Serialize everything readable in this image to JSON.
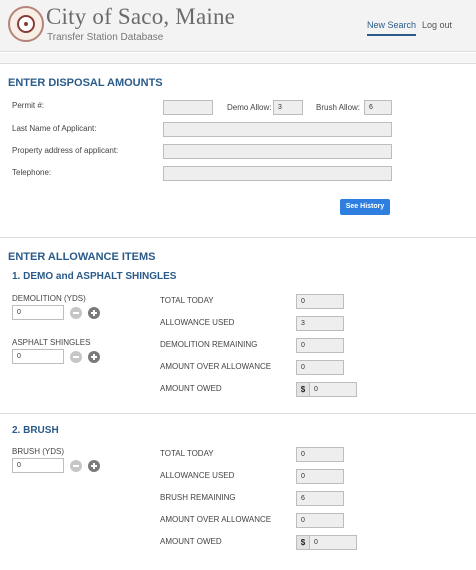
{
  "header": {
    "title": "City of Saco, Maine",
    "subtitle": "Transfer Station Database",
    "nav": {
      "new_search": "New Search",
      "logout": "Log out"
    }
  },
  "disposal": {
    "section_title": "ENTER DISPOSAL AMOUNTS",
    "permit_label": "Permit #:",
    "permit_value": "",
    "demo_allow_label": "Demo Allow:",
    "demo_allow_value": "3",
    "brush_allow_label": "Brush Allow:",
    "brush_allow_value": "6",
    "last_name_label": "Last Name of Applicant:",
    "last_name_value": "",
    "address_label": "Property address of applicant:",
    "address_value": "",
    "telephone_label": "Telephone:",
    "telephone_value": "",
    "see_history_button": "See History"
  },
  "allowance": {
    "section_title": "ENTER ALLOWANCE ITEMS",
    "demo": {
      "title": "1. DEMO and ASPHALT SHINGLES",
      "demolition_label": "DEMOLITION (YDS)",
      "demolition_value": "0",
      "shingles_label": "ASPHALT SHINGLES",
      "shingles_value": "0",
      "total_today_label": "TOTAL TODAY",
      "total_today_value": "0",
      "allowance_used_label": "ALLOWANCE USED",
      "allowance_used_value": "3",
      "remaining_label": "DEMOLITION REMAINING",
      "remaining_value": "0",
      "over_label": "AMOUNT OVER ALLOWANCE",
      "over_value": "0",
      "owed_label": "AMOUNT OWED",
      "owed_currency": "$",
      "owed_value": "0"
    },
    "brush": {
      "title": "2. BRUSH",
      "brush_label": "BRUSH (YDS)",
      "brush_value": "0",
      "total_today_label": "TOTAL TODAY",
      "total_today_value": "0",
      "allowance_used_label": "ALLOWANCE USED",
      "allowance_used_value": "0",
      "remaining_label": "BRUSH REMAINING",
      "remaining_value": "6",
      "over_label": "AMOUNT OVER ALLOWANCE",
      "over_value": "0",
      "owed_label": "AMOUNT OWED",
      "owed_currency": "$",
      "owed_value": "0"
    }
  },
  "colors": {
    "accent": "#2b5b8a",
    "button": "#2f7fe0",
    "seal": "#8c3c38"
  }
}
